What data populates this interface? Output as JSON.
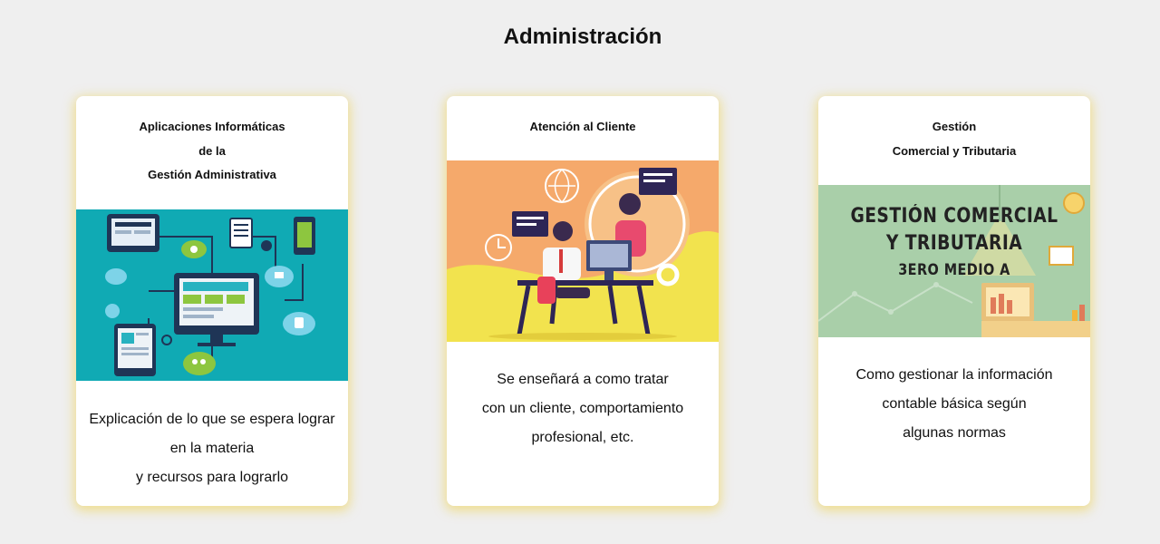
{
  "page": {
    "title": "Administración"
  },
  "cards": [
    {
      "title_lines": [
        "Aplicaciones Informáticas",
        "de la",
        "Gestión Administrativa"
      ],
      "desc_lines": [
        "Explicación de lo que se espera lograr",
        "en la materia",
        "y recursos para lograrlo"
      ],
      "image_icon": "connected-devices-illustration"
    },
    {
      "title_lines": [
        "Atención al Cliente"
      ],
      "desc_lines": [
        "Se enseñará a como tratar",
        "con un cliente, comportamiento",
        "profesional, etc."
      ],
      "image_icon": "customer-service-illustration"
    },
    {
      "title_lines": [
        "Gestión",
        "Comercial y Tributaria"
      ],
      "desc_lines": [
        "Como gestionar la información",
        "contable básica según",
        "algunas normas"
      ],
      "image_text_lines": [
        "GESTIÓN COMERCIAL",
        "Y TRIBUTARIA",
        "3ERO MEDIO A"
      ],
      "image_icon": "commercial-management-banner"
    }
  ]
}
